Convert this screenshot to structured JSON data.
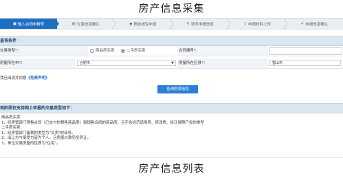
{
  "page_title": "房产信息采集",
  "bottom_title": "房产信息列表",
  "steps": [
    {
      "label": "输入合同申报号",
      "icon": "document-icon",
      "active": true
    },
    {
      "label": "交易信息确认",
      "icon": "list-icon",
      "active": false
    },
    {
      "label": "税收减免申请",
      "icon": "tag-icon",
      "active": false
    },
    {
      "label": "填写申报信息",
      "icon": "edit-icon",
      "active": false
    },
    {
      "label": "申报材料上传",
      "icon": "upload-icon",
      "active": false
    },
    {
      "label": "申报信息确认",
      "icon": "check-icon",
      "active": false
    }
  ],
  "query_section": {
    "title": "查询条件",
    "trade_type_label": "交易类型*：",
    "trade_options": [
      "商品房买卖",
      "二手房买卖"
    ],
    "trade_selected": "二手房买卖",
    "contract_label": "合同编号*：",
    "city_label": "房屋所在市*：",
    "city_value": "合肥市",
    "district_label": "房屋所在区县*：",
    "district_value": "蜀山市"
  },
  "agreement": {
    "prefix": "我已阅读并同意",
    "link": "《免责声明》"
  },
  "query_button": "查询房源信息",
  "supported_section": {
    "title": "现阶段仅支持网上申报的交易类型如下："
  },
  "notes": [
    "商品房买卖：",
    "1、经房管部门预售合同（已交付的预售商品房）和销售合同的商品房，且不含经济适用房、房改房、拆迁保障产权的类型",
    "二手房买卖：",
    "1、经房管部门备案的类型为\"买卖\"的业务。",
    "2、出让方与承受方皆为个人，且房屋价款完全转让。",
    "3、单位交易房屋的性质为\"住宅\"。"
  ]
}
